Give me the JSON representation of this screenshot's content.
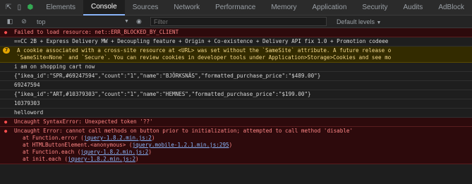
{
  "toolbar": {
    "inspect_icon": "cursor-arrow-icon",
    "device_icon": "device-toggle-icon",
    "extension_icon": "extension-icon",
    "tabs": [
      "Elements",
      "Console",
      "Sources",
      "Network",
      "Performance",
      "Memory",
      "Application",
      "Security",
      "Audits",
      "AdBlock"
    ],
    "active_tab": "Console"
  },
  "filterbar": {
    "context": "top",
    "filter_placeholder": "Filter",
    "levels": "Default levels"
  },
  "console": {
    "error1": "Failed to load resource: net::ERR_BLOCKED_BY_CLIENT",
    "log1": "==CC 2B + Express Delivery MW + Decoupling feature + Origin + Co-existence + Delivery API fix 1.0 + Promotion codeee",
    "warn_count": "7",
    "warn_line1": "A cookie associated with a cross-site resource at <URL> was set without the `SameSite` attribute. A future release o",
    "warn_line2": "`SameSite=None` and `Secure`. You can review cookies in developer tools under Application>Storage>Cookies and see mo",
    "log2": "i am on shopping cart now",
    "log3": "{\"ikea_id\":\"SPR,#69247594\",\"count\":\"1\",\"name\":\"BJÖRKSNÄS\",\"formatted_purchase_price\":\"$489.00\"}",
    "log4": "69247594",
    "log5": "{\"ikea_id\":\"ART,#10379303\",\"count\":\"1\",\"name\":\"HEMNES\",\"formatted_purchase_price\":\"$199.00\"}",
    "log6": "10379303",
    "log7": "helloword",
    "error2": "Uncaught SyntaxError: Unexpected token '??'",
    "error3": "Uncaught Error: cannot call methods on button prior to initialization; attempted to call method 'disable'",
    "stack": [
      {
        "prefix": "at Function.error (",
        "link": "jquery-1.8.2.min.js:2",
        "suffix": ")"
      },
      {
        "prefix": "at HTMLButtonElement.<anonymous> (",
        "link": "jquery.mobile-1.2.1.min.js:295",
        "suffix": ")"
      },
      {
        "prefix": "at Function.each (",
        "link": "jquery-1.8.2.min.js:2",
        "suffix": ")"
      },
      {
        "prefix": "at init.each (",
        "link": "jquery-1.8.2.min.js:2",
        "suffix": ")"
      }
    ]
  }
}
